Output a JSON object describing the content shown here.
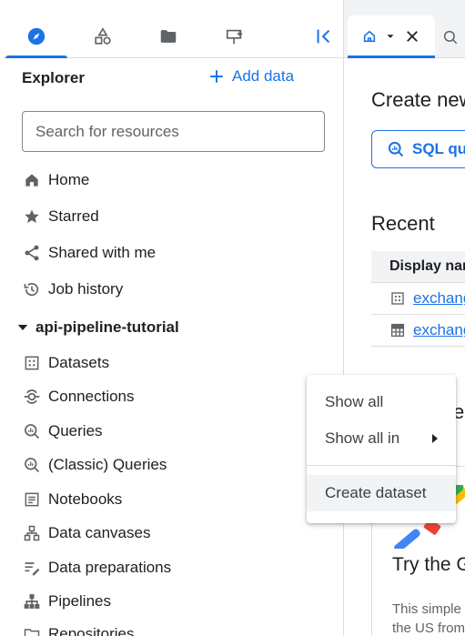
{
  "icon_tabs": [
    {
      "name": "explorer-compass-icon",
      "active": true
    },
    {
      "name": "shapes-icon",
      "active": false
    },
    {
      "name": "folder-icon",
      "active": false
    },
    {
      "name": "pipeline-sign-icon",
      "active": false
    }
  ],
  "explorer": {
    "title": "Explorer",
    "add_data_label": "Add data",
    "search_placeholder": "Search for resources"
  },
  "nav": [
    {
      "key": "home",
      "label": "Home",
      "icon": "home-icon"
    },
    {
      "key": "starred",
      "label": "Starred",
      "icon": "star-icon"
    },
    {
      "key": "shared",
      "label": "Shared with me",
      "icon": "share-icon"
    },
    {
      "key": "job-history",
      "label": "Job history",
      "icon": "history-icon"
    }
  ],
  "project": {
    "label": "api-pipeline-tutorial"
  },
  "project_items": [
    {
      "key": "datasets",
      "label": "Datasets",
      "icon": "dataset-icon"
    },
    {
      "key": "connections",
      "label": "Connections",
      "icon": "connection-icon"
    },
    {
      "key": "queries",
      "label": "Queries",
      "icon": "query-icon"
    },
    {
      "key": "classic-queries",
      "label": "(Classic) Queries",
      "icon": "query-icon"
    },
    {
      "key": "notebooks",
      "label": "Notebooks",
      "icon": "notebook-icon"
    },
    {
      "key": "data-canvases",
      "label": "Data canvases",
      "icon": "canvas-icon"
    },
    {
      "key": "data-preparations",
      "label": "Data preparations",
      "icon": "data-prep-icon"
    },
    {
      "key": "pipelines",
      "label": "Pipelines",
      "icon": "pipeline-icon"
    },
    {
      "key": "repositories",
      "label": "Repositories",
      "icon": "folder-icon"
    }
  ],
  "right": {
    "create_new": "Create new",
    "sql_button": "SQL query",
    "recent_title": "Recent",
    "table_header": "Display name",
    "rows": [
      {
        "label": "exchange_rates",
        "icon": "dataset-icon"
      },
      {
        "label": "exchange_rates",
        "icon": "table-icon"
      }
    ],
    "section_letter": "e",
    "promo_title": "Try the Gemini",
    "promo_body_1": "This simple",
    "promo_body_2": "the US from"
  },
  "menu": {
    "items": [
      "Show all",
      "Show all in"
    ],
    "create_dataset": "Create dataset"
  },
  "colors": {
    "accent": "#1a73e8",
    "text": "#202124",
    "muted": "#5f6368",
    "border": "#dadce0"
  }
}
